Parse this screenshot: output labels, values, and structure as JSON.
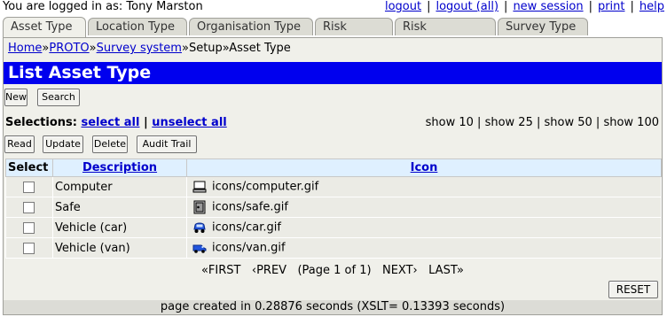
{
  "header": {
    "logged_in_text": "You are logged in as: Tony Marston",
    "links": [
      "logout",
      "logout (all)",
      "new session",
      "print",
      "help"
    ]
  },
  "tabs": [
    "Asset Type",
    "Location Type",
    "Organisation Type",
    "Risk Status",
    "Risk Weighting",
    "Survey Type"
  ],
  "breadcrumb": {
    "links": [
      "Home",
      "PROTO",
      "Survey system"
    ],
    "plain": [
      "Setup",
      "Asset Type"
    ],
    "separator": "»"
  },
  "page_title": "List Asset Type",
  "toolbar": {
    "new_label": "New",
    "search_label": "Search"
  },
  "selections": {
    "label": "Selections:",
    "select_all": "select all",
    "divider": "|",
    "unselect_all": "unselect all"
  },
  "show_options": [
    "show 10",
    "show 25",
    "show 50",
    "show 100"
  ],
  "actions": {
    "read": "Read",
    "update": "Update",
    "delete": "Delete",
    "audit": "Audit Trail"
  },
  "table": {
    "headers": {
      "select": "Select",
      "description": "Description",
      "icon": "Icon"
    },
    "rows": [
      {
        "description": "Computer",
        "icon": "icons/computer.gif",
        "icon_name": "computer-icon"
      },
      {
        "description": "Safe",
        "icon": "icons/safe.gif",
        "icon_name": "safe-icon"
      },
      {
        "description": "Vehicle (car)",
        "icon": "icons/car.gif",
        "icon_name": "car-icon"
      },
      {
        "description": "Vehicle (van)",
        "icon": "icons/van.gif",
        "icon_name": "van-icon"
      }
    ]
  },
  "pager": {
    "first": "«FIRST",
    "prev": "‹PREV",
    "info": "(Page 1 of 1)",
    "next": "NEXT›",
    "last": "LAST»"
  },
  "reset_label": "RESET",
  "footer_text": "page created in 0.28876 seconds (XSLT= 0.13393 seconds)",
  "colors": {
    "title_bar": "#0000ee",
    "link": "#0000cc",
    "header_row": "#dff0ff"
  }
}
